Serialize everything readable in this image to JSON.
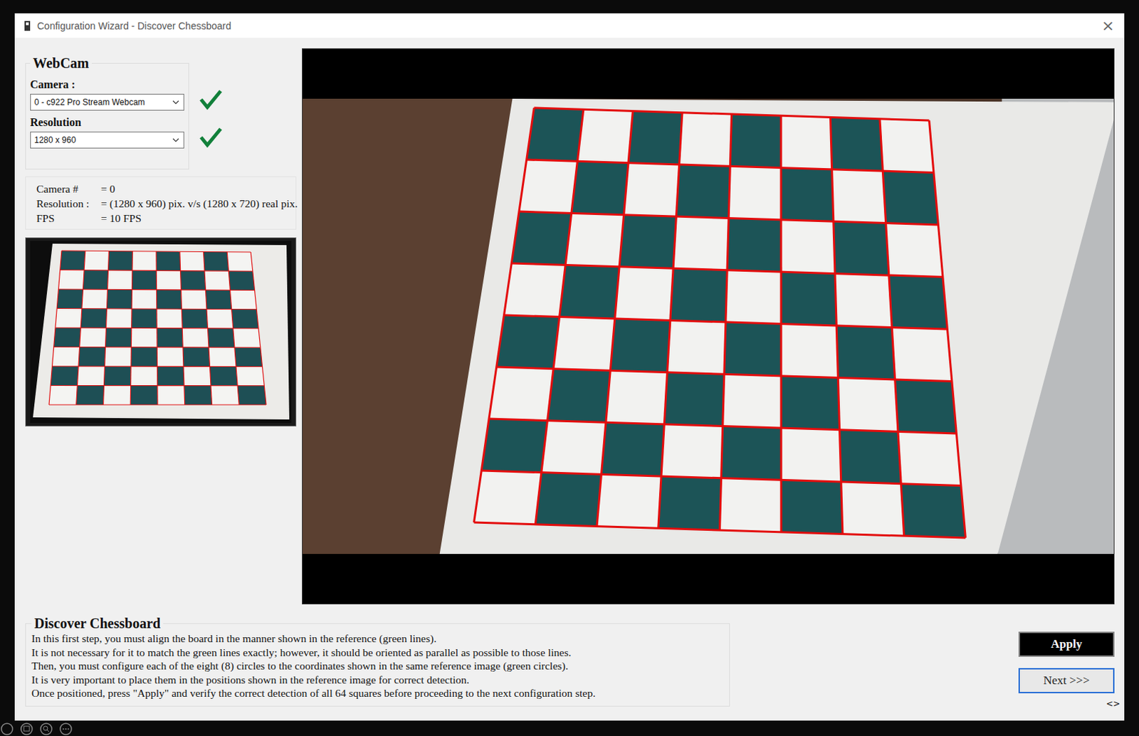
{
  "window": {
    "title": "Configuration Wizard - Discover Chessboard",
    "close": "×"
  },
  "webcam": {
    "title": "WebCam",
    "fields": [
      {
        "label": "Camera :",
        "value": "0 - c922 Pro Stream Webcam",
        "ok": true
      },
      {
        "label": "Resolution",
        "value": "1280 x 960",
        "ok": true
      }
    ]
  },
  "info": [
    {
      "label": "Camera #",
      "value": "= 0"
    },
    {
      "label": "Resolution :",
      "value": "= (1280 x 960) pix. v/s (1280 x 720) real pix."
    },
    {
      "label": "FPS",
      "value": "= 10 FPS"
    }
  ],
  "description": {
    "title": "Discover Chessboard",
    "lines": [
      "In this first step, you must align the board in the manner shown in the reference (green lines).",
      "It is not necessary for it to match the green lines exactly; however, it should be oriented as parallel as possible to those lines.",
      "Then, you must configure each of the eight (8) circles to the coordinates shown in the same reference image (green circles).",
      "It is very important to place them in the positions shown in the reference image for correct detection.",
      "Once positioned, press \"Apply\" and verify the correct detection of all 64 squares before proceeding to the next configuration step."
    ]
  },
  "buttons": [
    {
      "label": "Apply",
      "primary": true
    },
    {
      "label": "Next >>>",
      "primary": false
    }
  ],
  "corner_mark": "<>"
}
